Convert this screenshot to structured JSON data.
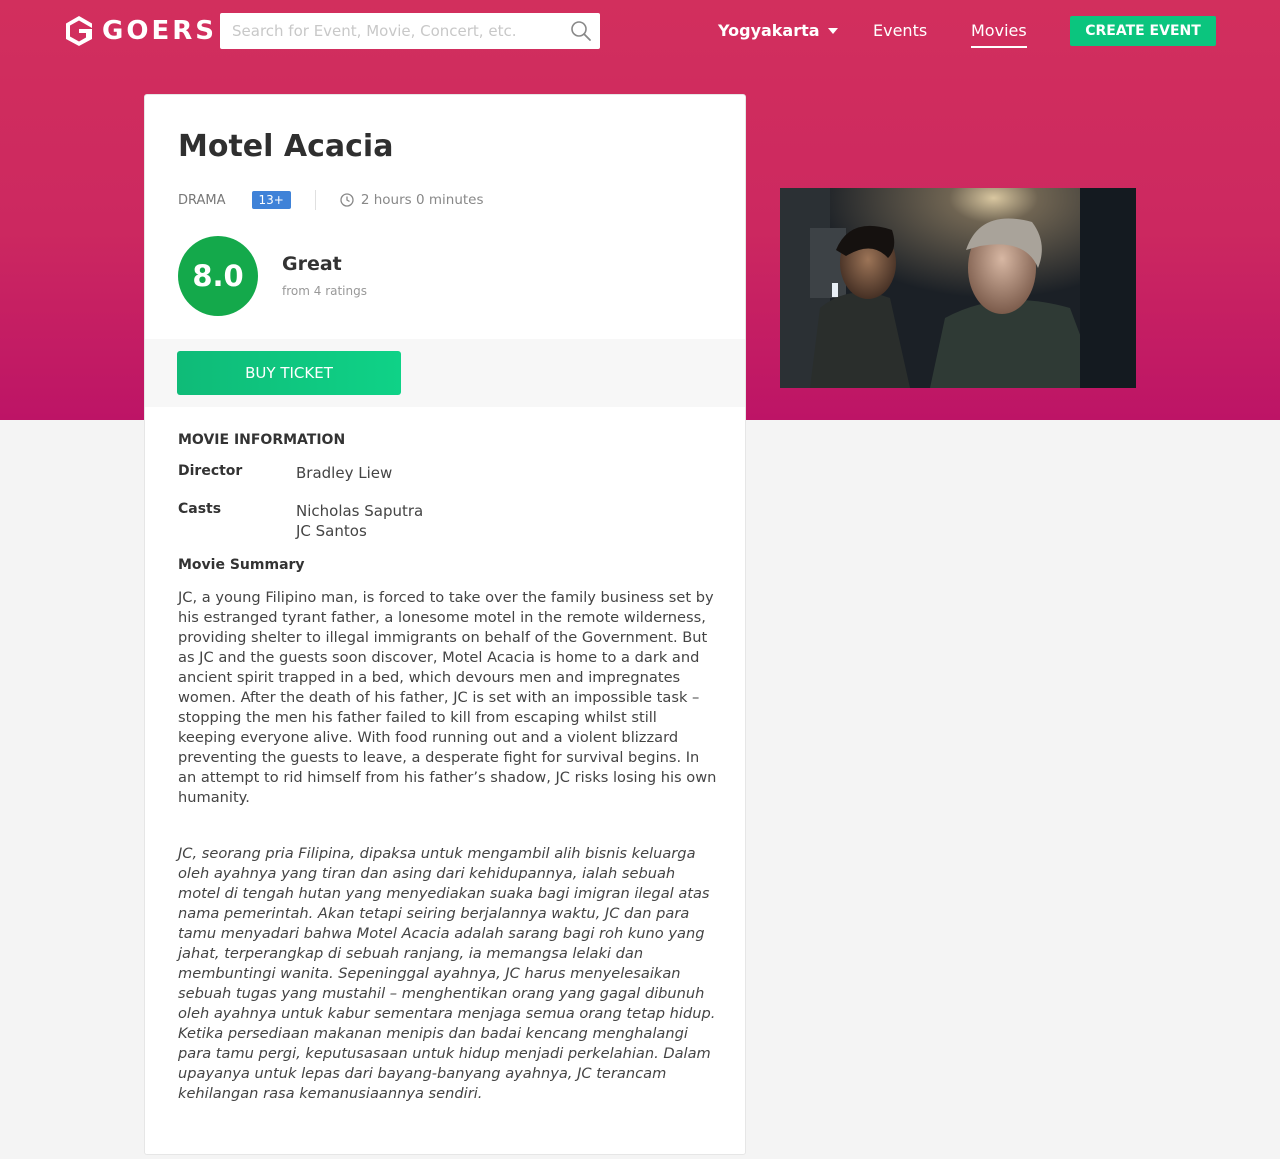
{
  "nav": {
    "logo_text": "GOERS",
    "search_placeholder": "Search for Event, Movie, Concert, etc.",
    "city": "Yogyakarta",
    "links": [
      "Events",
      "Movies"
    ],
    "create_event": "CREATE EVENT"
  },
  "movie": {
    "title": "Motel Acacia",
    "genre": "DRAMA",
    "rating_age": "13+",
    "duration": "2 hours 0 minutes",
    "score": "8.0",
    "score_label": "Great",
    "ratings_count": "from 4 ratings",
    "buy_label": "BUY TICKET"
  },
  "info": {
    "section_title": "MOVIE INFORMATION",
    "director_label": "Director",
    "director": "Bradley Liew",
    "casts_label": "Casts",
    "casts": [
      "Nicholas Saputra",
      "JC Santos"
    ],
    "summary_title": "Movie Summary",
    "summary_en": "JC, a young Filipino man, is forced to take over the family business set by his estranged tyrant father, a lonesome motel in the remote wilderness, providing shelter to illegal immigrants on behalf of the Government. But as JC and the guests soon discover, Motel Acacia is home to a dark and ancient spirit trapped in a bed, which devours men and impregnates women. After the death of his father, JC is set with an impossible task – stopping the men his father failed to kill from escaping whilst still keeping everyone alive. With food running out and a violent blizzard preventing the guests to leave, a desperate fight for survival begins. In an attempt to rid himself from his father’s shadow, JC risks losing his own humanity.",
    "summary_id": "JC, seorang pria Filipina, dipaksa untuk mengambil alih bisnis keluarga oleh ayahnya yang tiran dan asing dari kehidupannya, ialah sebuah motel di tengah hutan yang menyediakan suaka bagi imigran ilegal atas nama pemerintah. Akan tetapi seiring berjalannya waktu, JC dan para tamu menyadari bahwa Motel Acacia adalah sarang bagi roh kuno yang jahat, terperangkap di sebuah ranjang, ia memangsa lelaki dan membuntingi wanita. Sepeninggal ayahnya, JC harus menyelesaikan sebuah tugas yang mustahil – menghentikan orang yang gagal dibunuh oleh ayahnya untuk kabur sementara menjaga semua orang tetap hidup. Ketika persediaan makanan menipis dan badai kencang menghalangi para tamu pergi, keputusasaan untuk hidup menjadi perkelahian. Dalam upayanya untuk lepas dari bayang-banyang ayahnya, JC terancam kehilangan rasa kemanusiaannya sendiri."
  },
  "colors": {
    "brand": "#cf2c5e",
    "accent_green": "#0bc57e",
    "score_green": "#14a94b",
    "badge_blue": "#3f82d8"
  }
}
